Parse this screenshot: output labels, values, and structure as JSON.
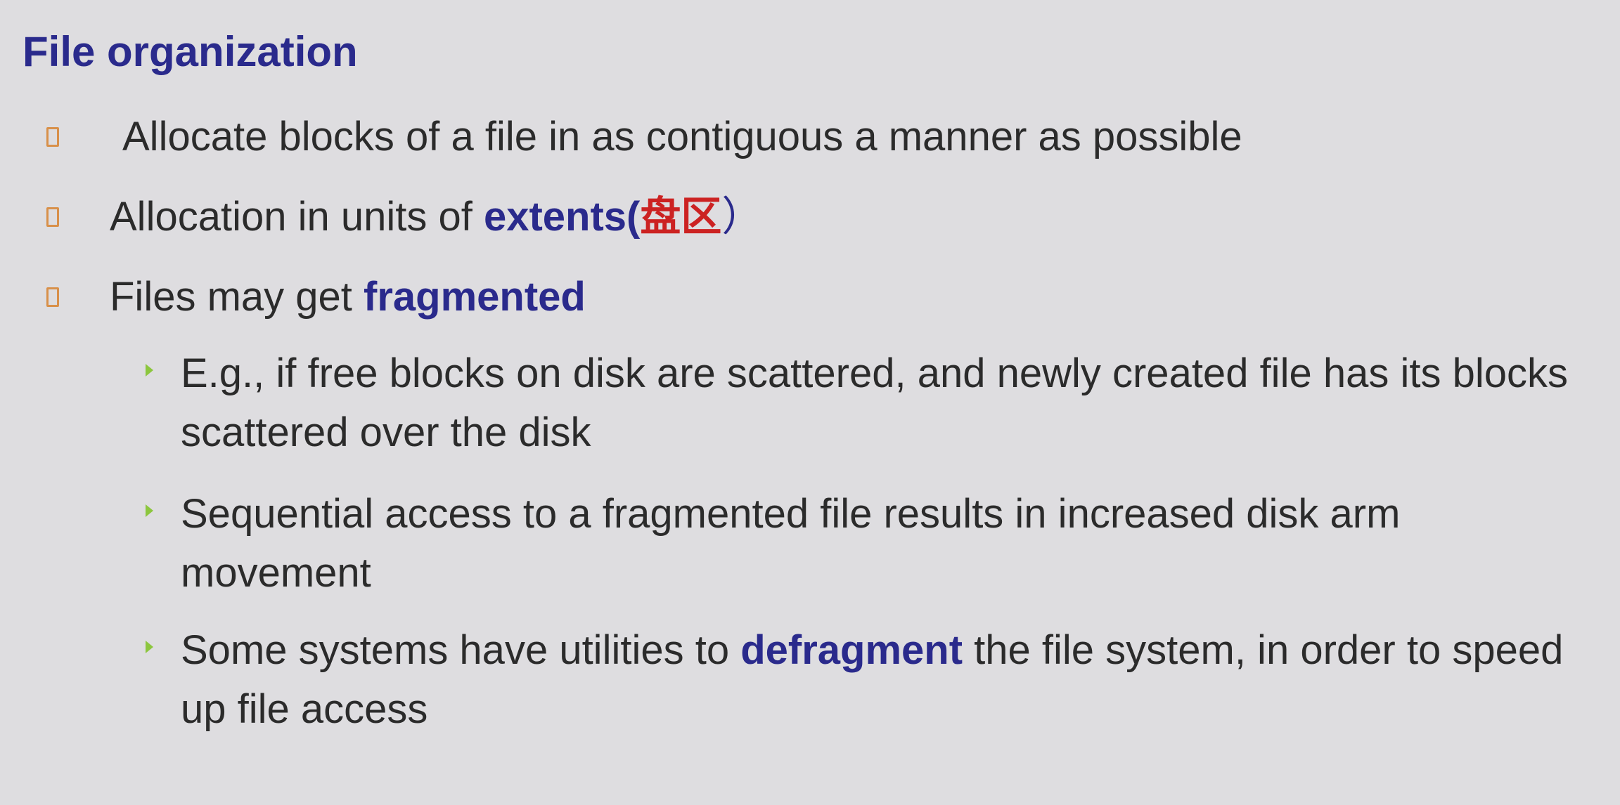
{
  "slide": {
    "title": "File organization",
    "bullets": [
      {
        "text": "Allocate blocks of a file in as contiguous a manner as possible"
      },
      {
        "prefix": "Allocation in units of ",
        "emphasis": "extents(",
        "cjk": "盘区",
        "suffix": "）"
      },
      {
        "prefix": "Files may get ",
        "emphasis": "fragmented"
      }
    ],
    "subbullets": [
      {
        "text": "E.g., if free blocks on disk are scattered, and newly created file has its blocks scattered over the disk"
      },
      {
        "text": "Sequential access to a fragmented file results in increased disk arm movement"
      },
      {
        "prefix": "Some systems have utilities to ",
        "emphasis": "defragment",
        "suffix": " the file system, in order to speed up file access"
      }
    ],
    "colors": {
      "background": "#dedde0",
      "title": "#2a2a8c",
      "emphasis": "#2a2a8c",
      "cjk": "#cc2222",
      "body_text": "#2b2b2b",
      "bullet_marker": "#d8904a",
      "subbullet_marker": "#8cc63e"
    },
    "icons": {
      "bullet": "hollow-square-bullet-icon",
      "subbullet": "triangle-bullet-icon"
    }
  }
}
